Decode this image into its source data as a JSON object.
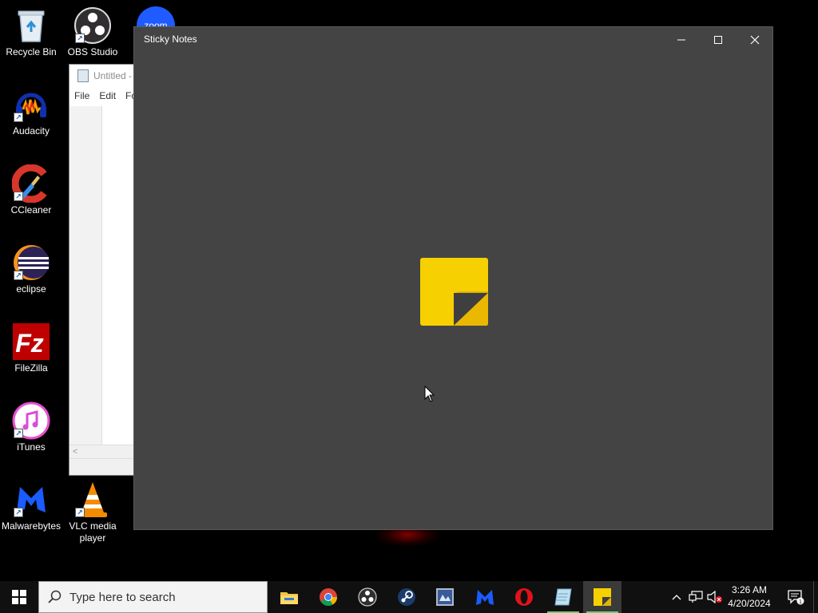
{
  "desktop": {
    "icons": [
      {
        "id": "recycle-bin",
        "label": "Recycle Bin",
        "icon": "recycle-bin-icon"
      },
      {
        "id": "obs",
        "label": "OBS Studio",
        "icon": "obs-studio-icon"
      },
      {
        "id": "zoom",
        "label": "zoom",
        "icon": "zoom-icon"
      },
      {
        "id": "audacity",
        "label": "Audacity",
        "icon": "audacity-icon"
      },
      {
        "id": "ccleaner",
        "label": "CCleaner",
        "icon": "ccleaner-icon"
      },
      {
        "id": "eclipse",
        "label": "eclipse",
        "icon": "eclipse-icon"
      },
      {
        "id": "filezilla",
        "label": "FileZilla",
        "icon": "filezilla-icon"
      },
      {
        "id": "itunes",
        "label": "iTunes",
        "icon": "itunes-icon"
      },
      {
        "id": "malwarebytes",
        "label": "Malwarebytes",
        "icon": "malwarebytes-icon"
      },
      {
        "id": "vlc",
        "label": "VLC media\nplayer",
        "icon": "vlc-icon"
      }
    ]
  },
  "notepad": {
    "title": "Untitled -",
    "menu": [
      "File",
      "Edit",
      "Fo"
    ],
    "scroll_glyph": "<"
  },
  "sticky_window": {
    "title": "Sticky Notes",
    "bg_color": "#444444",
    "logo_color": "#f5cf00"
  },
  "taskbar": {
    "search_placeholder": "Type here to search",
    "pinned": [
      {
        "name": "file-explorer",
        "icon": "file-explorer-icon"
      },
      {
        "name": "chrome",
        "icon": "chrome-icon"
      },
      {
        "name": "obs",
        "icon": "obs-studio-icon"
      },
      {
        "name": "steam",
        "icon": "steam-icon"
      },
      {
        "name": "unknown-app",
        "icon": "app-icon"
      },
      {
        "name": "malwarebytes",
        "icon": "malwarebytes-icon"
      },
      {
        "name": "opera",
        "icon": "opera-icon"
      },
      {
        "name": "notepad",
        "icon": "notepad-icon"
      },
      {
        "name": "sticky-notes",
        "icon": "sticky-notes-icon"
      }
    ],
    "clock": {
      "time": "3:26 AM",
      "date": "4/20/2024"
    },
    "notification_count": "1"
  }
}
